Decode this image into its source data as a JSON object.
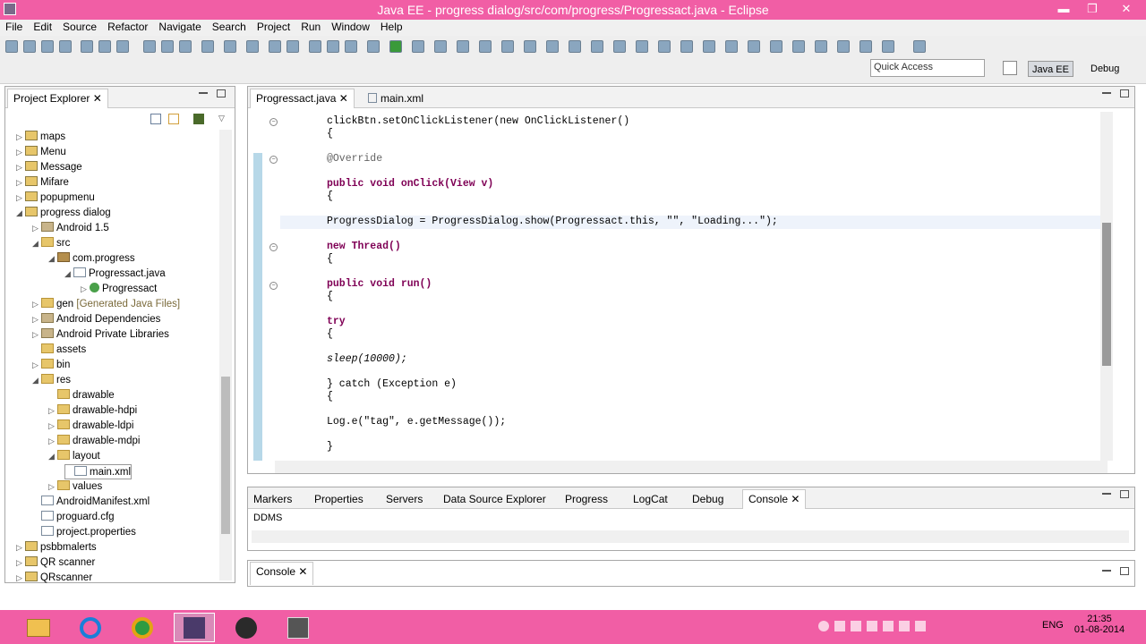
{
  "window": {
    "title": "Java EE - progress dialog/src/com/progress/Progressact.java - Eclipse",
    "minimize": "▬",
    "maximize": "❐",
    "close": "✕"
  },
  "menu": [
    "File",
    "Edit",
    "Source",
    "Refactor",
    "Navigate",
    "Search",
    "Project",
    "Run",
    "Window",
    "Help"
  ],
  "toolbar": {
    "quick_access_placeholder": "Quick Access",
    "perspective_javaee": "Java EE",
    "perspective_debug": "Debug"
  },
  "project_explorer": {
    "tab_label": "Project Explorer",
    "items": [
      {
        "label": "maps",
        "suffix": ""
      },
      {
        "label": "Menu",
        "suffix": ""
      },
      {
        "label": "Message",
        "suffix": ""
      },
      {
        "label": "Mifare",
        "suffix": ""
      },
      {
        "label": "popupmenu",
        "suffix": ""
      },
      {
        "label": "progress dialog",
        "suffix": ""
      },
      {
        "label": "Android 1.5",
        "suffix": ""
      },
      {
        "label": "src",
        "suffix": ""
      },
      {
        "label": "com.progress",
        "suffix": ""
      },
      {
        "label": "Progressact.java",
        "suffix": ""
      },
      {
        "label": "Progressact",
        "suffix": ""
      },
      {
        "label": "gen",
        "suffix": "[Generated Java Files]"
      },
      {
        "label": "Android Dependencies",
        "suffix": ""
      },
      {
        "label": "Android Private Libraries",
        "suffix": ""
      },
      {
        "label": "assets",
        "suffix": ""
      },
      {
        "label": "bin",
        "suffix": ""
      },
      {
        "label": "res",
        "suffix": ""
      },
      {
        "label": "drawable",
        "suffix": ""
      },
      {
        "label": "drawable-hdpi",
        "suffix": ""
      },
      {
        "label": "drawable-ldpi",
        "suffix": ""
      },
      {
        "label": "drawable-mdpi",
        "suffix": ""
      },
      {
        "label": "layout",
        "suffix": ""
      },
      {
        "label": "main.xml",
        "suffix": ""
      },
      {
        "label": "values",
        "suffix": ""
      },
      {
        "label": "AndroidManifest.xml",
        "suffix": ""
      },
      {
        "label": "proguard.cfg",
        "suffix": ""
      },
      {
        "label": "project.properties",
        "suffix": ""
      },
      {
        "label": "psbbmalerts",
        "suffix": ""
      },
      {
        "label": "QR scanner",
        "suffix": ""
      },
      {
        "label": "QRscanner",
        "suffix": ""
      }
    ]
  },
  "editor": {
    "tabs": [
      "Progressact.java",
      "main.xml"
    ],
    "lines": [
      "clickBtn.setOnClickListener(new OnClickListener()",
      "{",
      "@Override",
      "public void onClick(View v)",
      "{",
      "ProgressDialog = ProgressDialog.show(Progressact.this, \"\", \"Loading...\");",
      "new Thread()",
      "{",
      "public void run()",
      "{",
      "try",
      "{",
      "sleep(10000);",
      "} catch (Exception e)",
      "{",
      "Log.e(\"tag\", e.getMessage());",
      "}"
    ]
  },
  "bottom_panel": {
    "tabs": [
      "Markers",
      "Properties",
      "Servers",
      "Data Source Explorer",
      "Progress",
      "LogCat",
      "Debug",
      "Console"
    ],
    "content": "DDMS"
  },
  "console2": {
    "tab_label": "Console"
  },
  "taskbar": {
    "language": "ENG",
    "time": "21:35",
    "date": "01-08-2014"
  }
}
